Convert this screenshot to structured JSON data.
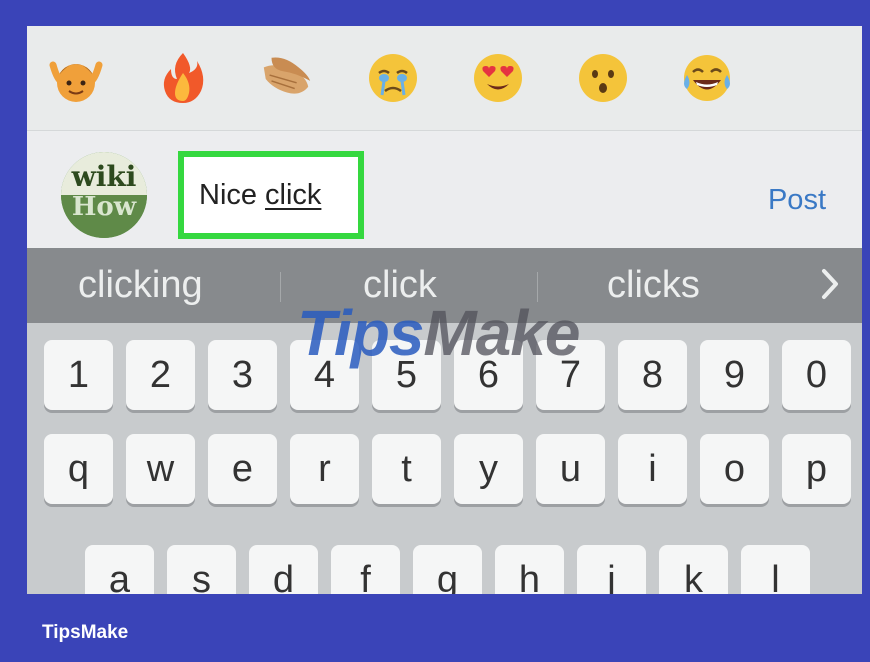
{
  "emoji_bar": {
    "items": [
      "raised-hands-boy",
      "fire",
      "clapping-hands",
      "crying-face",
      "heart-eyes-face",
      "surprised-face",
      "tears-of-joy-face"
    ]
  },
  "comment": {
    "avatar_top": "wiki",
    "avatar_bottom": "How",
    "text_word1": "Nice",
    "text_word2": "click",
    "post_label": "Post",
    "highlight_color": "#35d83f",
    "post_color": "#3a79c5"
  },
  "suggestions": {
    "items": [
      "clicking",
      "click",
      "clicks"
    ],
    "arrow_icon": "chevron-right-icon"
  },
  "keyboard": {
    "row_numbers": [
      "1",
      "2",
      "3",
      "4",
      "5",
      "6",
      "7",
      "8",
      "9",
      "0"
    ],
    "row_qwerty": [
      "q",
      "w",
      "e",
      "r",
      "t",
      "y",
      "u",
      "i",
      "o",
      "p"
    ],
    "row_asdf": [
      "a",
      "s",
      "d",
      "f",
      "g",
      "h",
      "j",
      "k",
      "l"
    ]
  },
  "watermark": {
    "part1": "Tips",
    "part2": "Make"
  },
  "footer": {
    "brand": "TipsMake"
  }
}
